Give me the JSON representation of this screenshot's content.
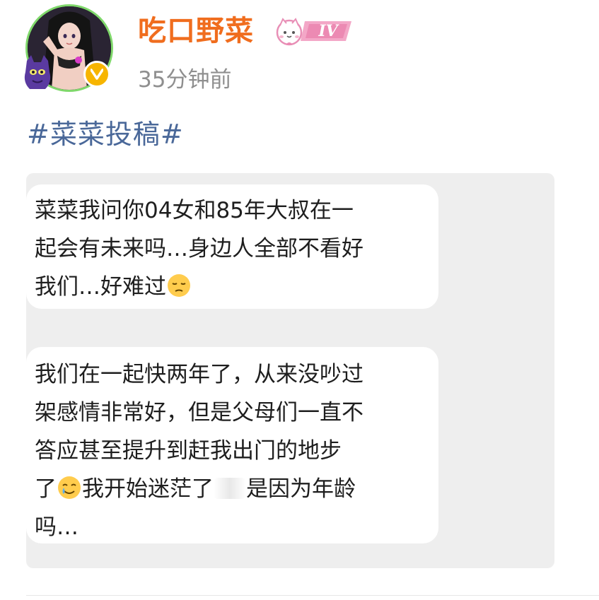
{
  "post": {
    "username": "吃口野菜",
    "level_badge": "IV",
    "timestamp": "35分钟前",
    "hashtag": "#菜菜投稿#"
  },
  "chat": {
    "message1": {
      "line1": "菜菜我问你04女和85年大叔在一",
      "line2": "起会有未来吗…身边人全部不看好",
      "line3": "我们…好难过",
      "emoji": "pensive-face"
    },
    "message2": {
      "line1": "我们在一起快两年了，从来没吵过",
      "line2": "架感情非常好，但是父母们一直不",
      "line3": "答应甚至提升到赶我出门的地步",
      "line4a": "了",
      "emoji": "smiling-face-with-tear",
      "line4b": "我开始迷茫了",
      "line4c": "是因为年龄",
      "line5": "吗…"
    }
  },
  "colors": {
    "username": "#f06d1e",
    "timestamp": "#8f8f8f",
    "hashtag": "#4a6899",
    "verify_badge": "#f7b500",
    "avatar_ring": "#7fd86b",
    "chat_background": "#eeeeee"
  },
  "icons": {
    "verify": "verified-v-icon",
    "level": "cat-level-badge-icon",
    "mascot": "purple-mascot-icon"
  }
}
